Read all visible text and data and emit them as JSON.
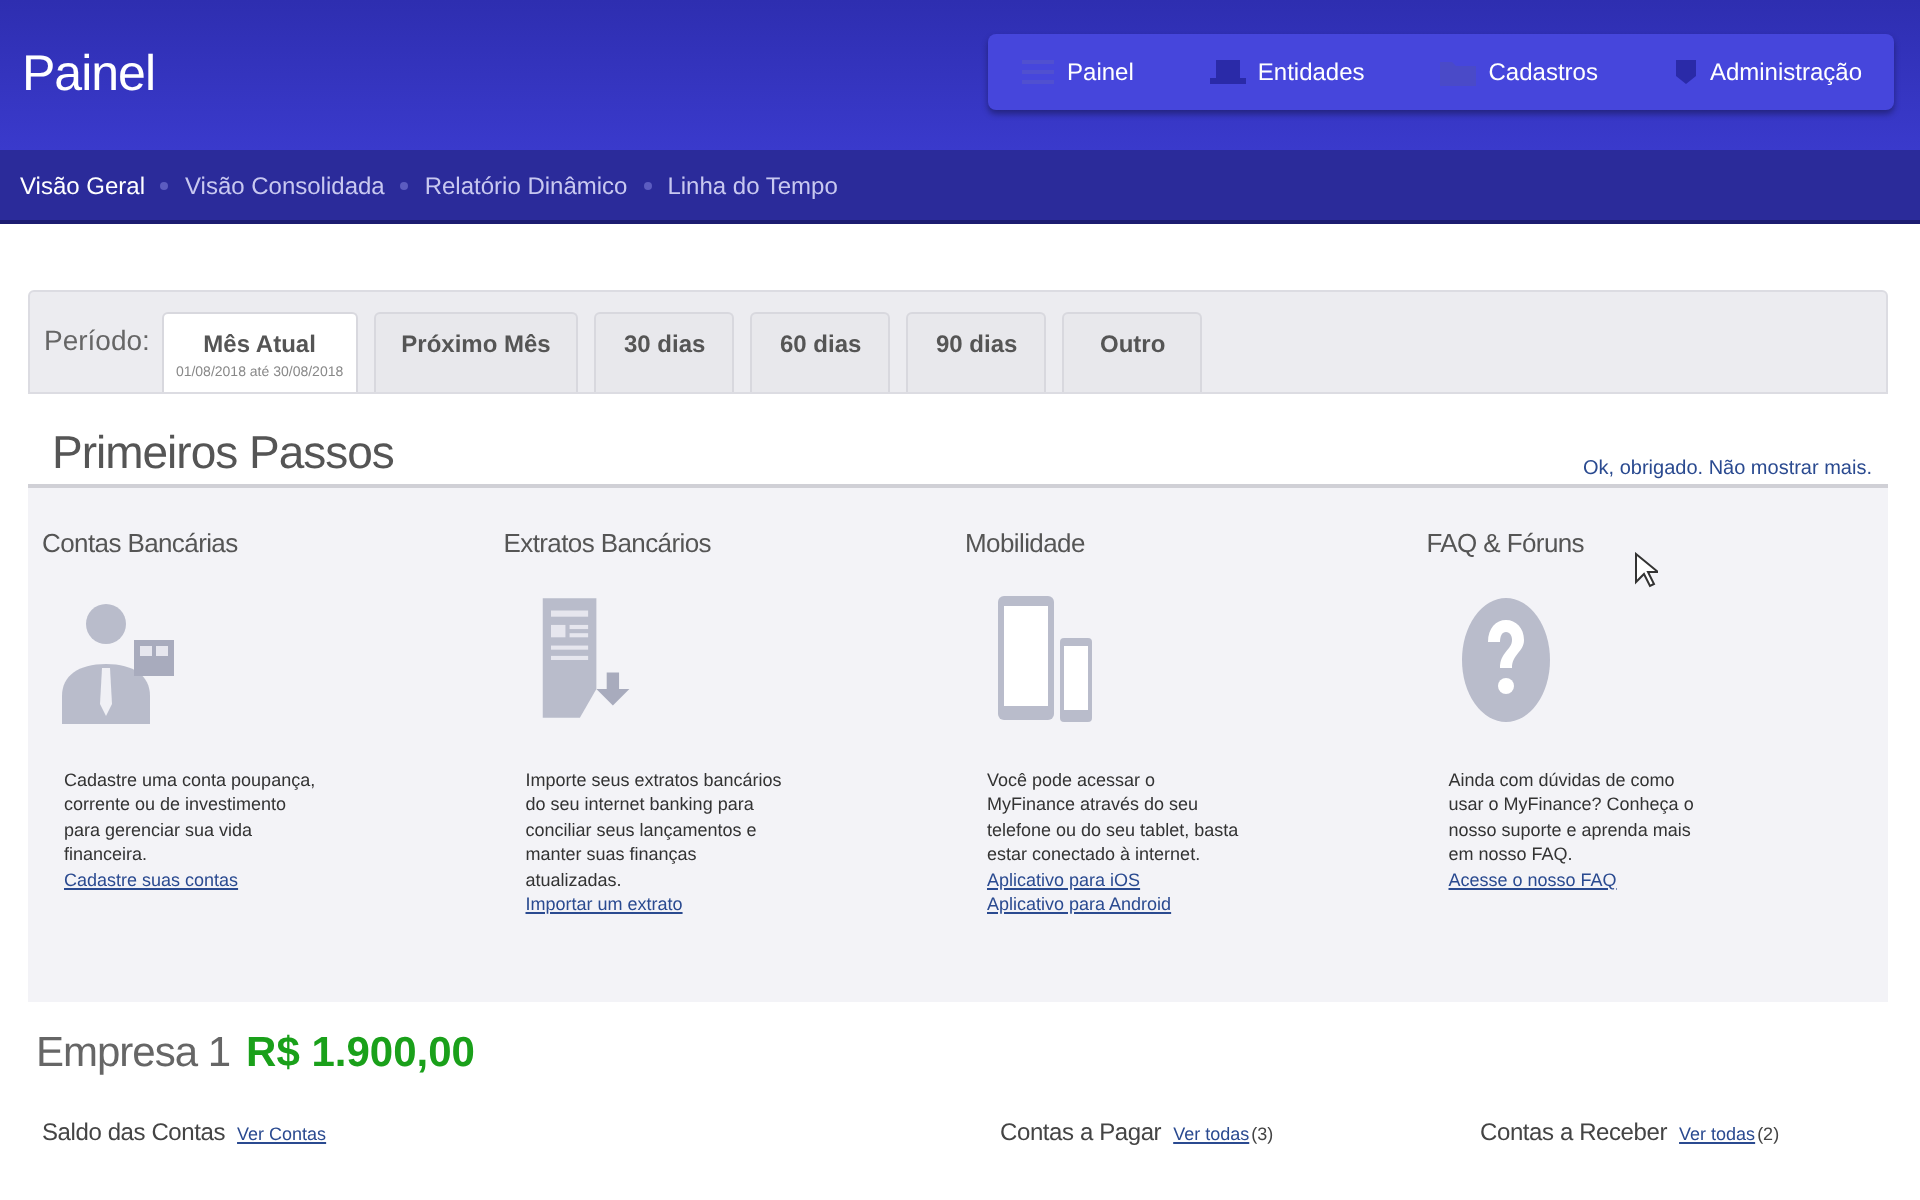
{
  "header": {
    "title": "Painel",
    "menu": [
      {
        "label": "Painel",
        "kind": "list"
      },
      {
        "label": "Entidades",
        "kind": "laptop"
      },
      {
        "label": "Cadastros",
        "kind": "folder"
      },
      {
        "label": "Administração",
        "kind": "shield"
      }
    ]
  },
  "subnav": [
    {
      "label": "Visão Geral",
      "selected": true
    },
    {
      "label": "Visão Consolidada",
      "selected": false
    },
    {
      "label": "Relatório Dinâmico",
      "selected": false
    },
    {
      "label": "Linha do Tempo",
      "selected": false
    }
  ],
  "period": {
    "label": "Período:",
    "tabs": [
      {
        "label": "Mês Atual",
        "sub": "01/08/2018 até 30/08/2018",
        "selected": true
      },
      {
        "label": "Próximo Mês",
        "selected": false
      },
      {
        "label": "30 dias",
        "selected": false
      },
      {
        "label": "60 dias",
        "selected": false
      },
      {
        "label": "90 dias",
        "selected": false
      },
      {
        "label": "Outro",
        "selected": false
      }
    ]
  },
  "getting_started": {
    "title": "Primeiros Passos",
    "dismiss": "Ok, obrigado. Não mostrar mais.",
    "cards": [
      {
        "kind": "person",
        "title": "Contas Bancárias",
        "text": "Cadastre uma conta poupança, corrente ou de investimento para gerenciar sua vida financeira.",
        "links": [
          "Cadastre suas contas"
        ]
      },
      {
        "kind": "document",
        "title": "Extratos Bancários",
        "text": "Importe seus extratos bancários do seu internet banking para conciliar seus lançamentos e manter suas finanças atualizadas.",
        "links": [
          "Importar um extrato"
        ]
      },
      {
        "kind": "devices",
        "title": "Mobilidade",
        "text": "Você pode acessar o MyFinance através do seu telefone ou do seu tablet, basta estar conectado à internet.",
        "links": [
          "Aplicativo para iOS",
          "Aplicativo para Android"
        ]
      },
      {
        "kind": "question",
        "title": "FAQ & Fóruns",
        "text": "Ainda com dúvidas de como usar o MyFinance? Conheça o nosso suporte e aprenda mais em nosso FAQ.",
        "links": [
          "Acesse o nosso FAQ"
        ]
      }
    ]
  },
  "company": {
    "name": "Empresa 1",
    "balance": "R$ 1.900,00"
  },
  "sections": [
    {
      "title": "Saldo das Contas",
      "link": "Ver Contas"
    },
    {
      "title": "Contas a Pagar",
      "link": "Ver todas",
      "count": "(3)"
    },
    {
      "title": "Contas a Receber",
      "link": "Ver todas",
      "count": "(2)"
    }
  ]
}
